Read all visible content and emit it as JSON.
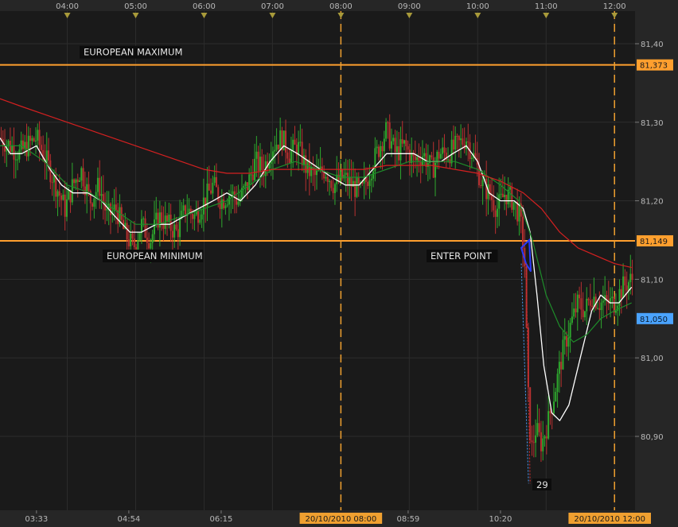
{
  "chart_data": {
    "type": "line",
    "subtype": "candlestick-with-moving-averages",
    "time_axis": {
      "top_ticks": [
        "04:00",
        "05:00",
        "06:00",
        "07:00",
        "08:00",
        "09:00",
        "10:00",
        "11:00",
        "12:00"
      ],
      "bottom_ticks": [
        "03:33",
        "04:54",
        "06:15",
        "08:59",
        "10:20"
      ],
      "highlighted_ticks": [
        "20/10/2010 08:00",
        "20/10/2010 12:00"
      ],
      "top_tick_minutes": [
        240,
        300,
        360,
        420,
        480,
        540,
        600,
        660,
        720
      ],
      "bottom_tick_minutes": [
        213,
        294,
        375,
        539,
        620
      ],
      "highlighted_tick_minutes": [
        480,
        720
      ],
      "range_minutes": [
        181,
        738
      ]
    },
    "y_axis": {
      "ticks": [
        "81,40",
        "81,30",
        "81,20",
        "81,10",
        "81,00",
        "80,90"
      ],
      "tick_values": [
        81.4,
        81.3,
        81.2,
        81.1,
        81.0,
        80.9
      ],
      "ylim": [
        80.83,
        81.45
      ]
    },
    "horizontal_levels": [
      {
        "name": "EUROPEAN MAXIMUM",
        "value": 81.373,
        "badge": "81,373",
        "color": "#ff9f2e"
      },
      {
        "name": "EUROPEAN MINIMUM",
        "value": 81.149,
        "badge": "81,149",
        "color": "#ff9f2e"
      }
    ],
    "current_price": {
      "value": 81.05,
      "badge": "81,050",
      "color": "#4aa3ff"
    },
    "vertical_markers_minutes": [
      480,
      720
    ],
    "annotations": [
      {
        "text": "ENTER POINT"
      },
      {
        "text": "29"
      }
    ],
    "series": [
      {
        "kind": "price",
        "points": [
          [
            181,
            81.28
          ],
          [
            190,
            81.27
          ],
          [
            198,
            81.26
          ],
          [
            205,
            81.27
          ],
          [
            213,
            81.28
          ],
          [
            222,
            81.25
          ],
          [
            230,
            81.22
          ],
          [
            238,
            81.19
          ],
          [
            245,
            81.22
          ],
          [
            252,
            81.24
          ],
          [
            260,
            81.2
          ],
          [
            268,
            81.22
          ],
          [
            275,
            81.18
          ],
          [
            283,
            81.19
          ],
          [
            290,
            81.16
          ],
          [
            298,
            81.14
          ],
          [
            305,
            81.17
          ],
          [
            313,
            81.15
          ],
          [
            320,
            81.18
          ],
          [
            328,
            81.17
          ],
          [
            336,
            81.16
          ],
          [
            344,
            81.19
          ],
          [
            352,
            81.18
          ],
          [
            360,
            81.2
          ],
          [
            368,
            81.22
          ],
          [
            375,
            81.2
          ],
          [
            383,
            81.21
          ],
          [
            390,
            81.2
          ],
          [
            398,
            81.22
          ],
          [
            405,
            81.25
          ],
          [
            412,
            81.24
          ],
          [
            420,
            81.27
          ],
          [
            428,
            81.28
          ],
          [
            435,
            81.26
          ],
          [
            442,
            81.27
          ],
          [
            450,
            81.24
          ],
          [
            458,
            81.23
          ],
          [
            466,
            81.24
          ],
          [
            474,
            81.22
          ],
          [
            482,
            81.23
          ],
          [
            490,
            81.22
          ],
          [
            498,
            81.21
          ],
          [
            506,
            81.24
          ],
          [
            514,
            81.27
          ],
          [
            520,
            81.29
          ],
          [
            528,
            81.26
          ],
          [
            536,
            81.27
          ],
          [
            544,
            81.25
          ],
          [
            552,
            81.26
          ],
          [
            560,
            81.24
          ],
          [
            566,
            81.26
          ],
          [
            574,
            81.26
          ],
          [
            582,
            81.27
          ],
          [
            590,
            81.28
          ],
          [
            598,
            81.25
          ],
          [
            604,
            81.22
          ],
          [
            610,
            81.21
          ],
          [
            617,
            81.19
          ],
          [
            624,
            81.21
          ],
          [
            631,
            81.2
          ],
          [
            637,
            81.18
          ],
          [
            641,
            81.13
          ],
          [
            644,
            80.96
          ],
          [
            647,
            80.88
          ],
          [
            651,
            80.91
          ],
          [
            656,
            80.89
          ],
          [
            662,
            80.92
          ],
          [
            668,
            80.96
          ],
          [
            675,
            81.01
          ],
          [
            681,
            81.04
          ],
          [
            688,
            81.07
          ],
          [
            694,
            81.06
          ],
          [
            700,
            81.08
          ],
          [
            707,
            81.07
          ],
          [
            713,
            81.07
          ],
          [
            720,
            81.07
          ],
          [
            727,
            81.09
          ],
          [
            735,
            81.1
          ]
        ]
      },
      {
        "kind": "fast-ma",
        "color": "#ffffff",
        "points": [
          [
            181,
            81.28
          ],
          [
            190,
            81.26
          ],
          [
            200,
            81.26
          ],
          [
            213,
            81.27
          ],
          [
            225,
            81.24
          ],
          [
            235,
            81.22
          ],
          [
            245,
            81.21
          ],
          [
            258,
            81.21
          ],
          [
            270,
            81.2
          ],
          [
            282,
            81.18
          ],
          [
            295,
            81.16
          ],
          [
            305,
            81.16
          ],
          [
            318,
            81.17
          ],
          [
            330,
            81.17
          ],
          [
            342,
            81.18
          ],
          [
            355,
            81.19
          ],
          [
            368,
            81.2
          ],
          [
            380,
            81.21
          ],
          [
            392,
            81.2
          ],
          [
            405,
            81.22
          ],
          [
            418,
            81.25
          ],
          [
            430,
            81.27
          ],
          [
            442,
            81.26
          ],
          [
            452,
            81.25
          ],
          [
            462,
            81.24
          ],
          [
            472,
            81.23
          ],
          [
            484,
            81.22
          ],
          [
            496,
            81.22
          ],
          [
            508,
            81.24
          ],
          [
            520,
            81.26
          ],
          [
            532,
            81.26
          ],
          [
            544,
            81.26
          ],
          [
            556,
            81.25
          ],
          [
            568,
            81.25
          ],
          [
            578,
            81.26
          ],
          [
            590,
            81.27
          ],
          [
            600,
            81.25
          ],
          [
            610,
            81.21
          ],
          [
            620,
            81.2
          ],
          [
            632,
            81.2
          ],
          [
            640,
            81.19
          ],
          [
            646,
            81.16
          ],
          [
            652,
            81.08
          ],
          [
            658,
            80.99
          ],
          [
            665,
            80.93
          ],
          [
            672,
            80.92
          ],
          [
            680,
            80.94
          ],
          [
            690,
            81.0
          ],
          [
            700,
            81.06
          ],
          [
            708,
            81.08
          ],
          [
            716,
            81.07
          ],
          [
            724,
            81.07
          ],
          [
            735,
            81.09
          ]
        ]
      },
      {
        "kind": "medium-ma",
        "color": "#1e8c2a",
        "points": [
          [
            181,
            81.27
          ],
          [
            200,
            81.27
          ],
          [
            220,
            81.25
          ],
          [
            240,
            81.22
          ],
          [
            260,
            81.21
          ],
          [
            280,
            81.19
          ],
          [
            300,
            81.17
          ],
          [
            320,
            81.17
          ],
          [
            340,
            81.18
          ],
          [
            360,
            81.19
          ],
          [
            380,
            81.2
          ],
          [
            400,
            81.22
          ],
          [
            420,
            81.24
          ],
          [
            440,
            81.25
          ],
          [
            460,
            81.24
          ],
          [
            480,
            81.23
          ],
          [
            500,
            81.23
          ],
          [
            520,
            81.24
          ],
          [
            540,
            81.25
          ],
          [
            560,
            81.25
          ],
          [
            580,
            81.25
          ],
          [
            600,
            81.24
          ],
          [
            620,
            81.22
          ],
          [
            636,
            81.2
          ],
          [
            648,
            81.15
          ],
          [
            660,
            81.08
          ],
          [
            672,
            81.04
          ],
          [
            684,
            81.02
          ],
          [
            696,
            81.03
          ],
          [
            708,
            81.05
          ],
          [
            720,
            81.06
          ],
          [
            735,
            81.07
          ]
        ]
      },
      {
        "kind": "slow-ma",
        "color": "#d42020",
        "points": [
          [
            181,
            81.33
          ],
          [
            200,
            81.32
          ],
          [
            220,
            81.31
          ],
          [
            240,
            81.3
          ],
          [
            260,
            81.29
          ],
          [
            280,
            81.28
          ],
          [
            300,
            81.27
          ],
          [
            320,
            81.26
          ],
          [
            340,
            81.25
          ],
          [
            360,
            81.24
          ],
          [
            380,
            81.235
          ],
          [
            400,
            81.235
          ],
          [
            420,
            81.24
          ],
          [
            440,
            81.24
          ],
          [
            460,
            81.24
          ],
          [
            480,
            81.24
          ],
          [
            500,
            81.24
          ],
          [
            520,
            81.245
          ],
          [
            540,
            81.245
          ],
          [
            560,
            81.245
          ],
          [
            580,
            81.24
          ],
          [
            600,
            81.235
          ],
          [
            620,
            81.225
          ],
          [
            640,
            81.21
          ],
          [
            656,
            81.19
          ],
          [
            672,
            81.16
          ],
          [
            688,
            81.14
          ],
          [
            704,
            81.13
          ],
          [
            720,
            81.12
          ],
          [
            735,
            81.115
          ]
        ]
      }
    ]
  }
}
